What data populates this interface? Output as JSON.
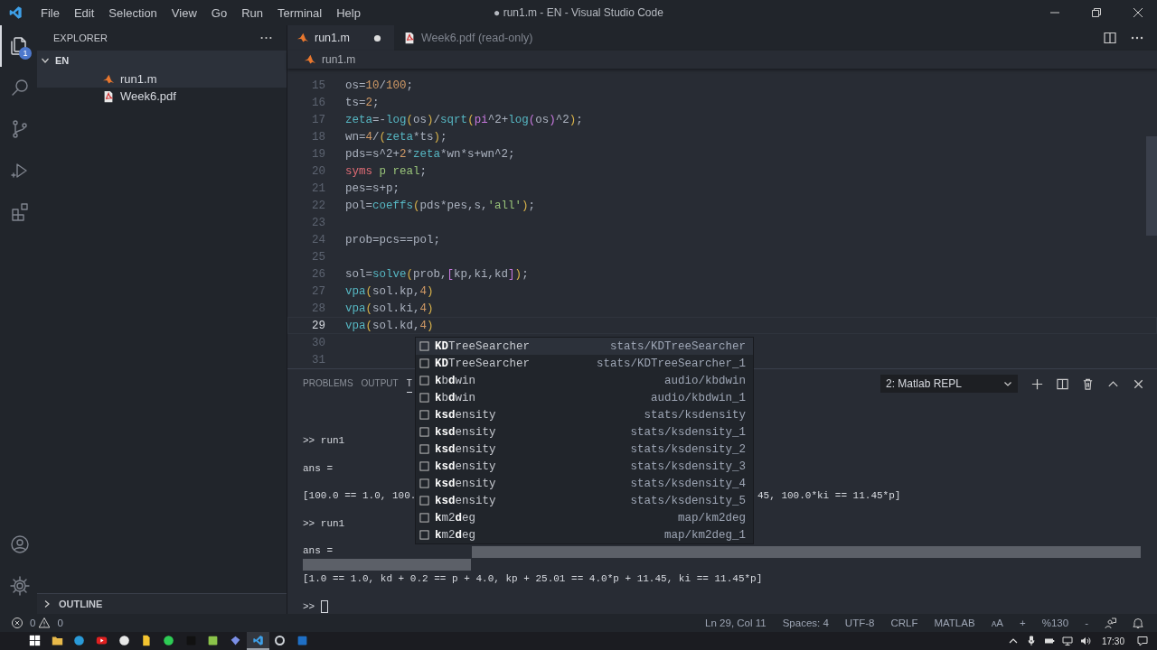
{
  "window": {
    "title": "● run1.m - EN - Visual Studio Code"
  },
  "menu": [
    "File",
    "Edit",
    "Selection",
    "View",
    "Go",
    "Run",
    "Terminal",
    "Help"
  ],
  "activity": [
    {
      "kind": "files",
      "selected": true,
      "badge": "1"
    },
    {
      "kind": "search",
      "selected": false
    },
    {
      "kind": "scm",
      "selected": false
    },
    {
      "kind": "run",
      "selected": false
    },
    {
      "kind": "extensions",
      "selected": false
    }
  ],
  "activity_bottom": [
    {
      "kind": "account"
    },
    {
      "kind": "settings"
    }
  ],
  "explorer": {
    "title": "EXPLORER",
    "folder": {
      "label": "EN",
      "expanded": true,
      "files": [
        {
          "label": "run1.m",
          "kind": "matlab",
          "selected": true
        },
        {
          "label": "Week6.pdf",
          "kind": "pdf",
          "selected": false
        }
      ]
    },
    "outline": {
      "label": "OUTLINE",
      "expanded": false
    }
  },
  "tabs": [
    {
      "label": "run1.m",
      "kind": "matlab",
      "selected": true,
      "dirty": true
    },
    {
      "label": "Week6.pdf (read-only)",
      "kind": "pdf",
      "selected": false,
      "dirty": false
    }
  ],
  "breadcrumb": {
    "label": "run1.m",
    "kind": "matlab"
  },
  "code": {
    "lines": [
      {
        "number": "15",
        "current": false,
        "tokens": [
          {
            "kind": "plain",
            "text": "os="
          },
          {
            "kind": "num",
            "text": "10"
          },
          {
            "kind": "plain",
            "text": "/"
          },
          {
            "kind": "num",
            "text": "100"
          },
          {
            "kind": "plain",
            "text": ";"
          }
        ]
      },
      {
        "number": "16",
        "current": false,
        "tokens": [
          {
            "kind": "plain",
            "text": "ts="
          },
          {
            "kind": "num",
            "text": "2"
          },
          {
            "kind": "plain",
            "text": ";"
          }
        ]
      },
      {
        "number": "17",
        "current": false,
        "tokens": [
          {
            "kind": "fn",
            "text": "zeta"
          },
          {
            "kind": "plain",
            "text": "=-"
          },
          {
            "kind": "fn",
            "text": "log"
          },
          {
            "kind": "p1",
            "text": "("
          },
          {
            "kind": "plain",
            "text": "os"
          },
          {
            "kind": "p1",
            "text": ")"
          },
          {
            "kind": "plain",
            "text": "/"
          },
          {
            "kind": "fn",
            "text": "sqrt"
          },
          {
            "kind": "p1",
            "text": "("
          },
          {
            "kind": "const",
            "text": "pi"
          },
          {
            "kind": "plain",
            "text": "^2+"
          },
          {
            "kind": "fn",
            "text": "log"
          },
          {
            "kind": "p2",
            "text": "("
          },
          {
            "kind": "plain",
            "text": "os"
          },
          {
            "kind": "p2",
            "text": ")"
          },
          {
            "kind": "plain",
            "text": "^2"
          },
          {
            "kind": "p1",
            "text": ")"
          },
          {
            "kind": "plain",
            "text": ";"
          }
        ]
      },
      {
        "number": "18",
        "current": false,
        "tokens": [
          {
            "kind": "plain",
            "text": "wn="
          },
          {
            "kind": "num",
            "text": "4"
          },
          {
            "kind": "plain",
            "text": "/"
          },
          {
            "kind": "p1",
            "text": "("
          },
          {
            "kind": "fn",
            "text": "zeta"
          },
          {
            "kind": "plain",
            "text": "*ts"
          },
          {
            "kind": "p1",
            "text": ")"
          },
          {
            "kind": "plain",
            "text": ";"
          }
        ]
      },
      {
        "number": "19",
        "current": false,
        "tokens": [
          {
            "kind": "plain",
            "text": "pds=s^2+"
          },
          {
            "kind": "num",
            "text": "2"
          },
          {
            "kind": "plain",
            "text": "*"
          },
          {
            "kind": "fn",
            "text": "zeta"
          },
          {
            "kind": "plain",
            "text": "*wn*s+wn^2;"
          }
        ]
      },
      {
        "number": "20",
        "current": false,
        "tokens": [
          {
            "kind": "kw",
            "text": "syms"
          },
          {
            "kind": "var",
            "text": " p"
          },
          {
            "kind": "var",
            "text": " real"
          },
          {
            "kind": "plain",
            "text": ";"
          }
        ]
      },
      {
        "number": "21",
        "current": false,
        "tokens": [
          {
            "kind": "plain",
            "text": "pes=s+p;"
          }
        ]
      },
      {
        "number": "22",
        "current": false,
        "tokens": [
          {
            "kind": "plain",
            "text": "pol="
          },
          {
            "kind": "fn",
            "text": "coeffs"
          },
          {
            "kind": "p1",
            "text": "("
          },
          {
            "kind": "plain",
            "text": "pds*pes,s,"
          },
          {
            "kind": "str",
            "text": "'all'"
          },
          {
            "kind": "p1",
            "text": ")"
          },
          {
            "kind": "plain",
            "text": ";"
          }
        ]
      },
      {
        "number": "23",
        "current": false
      },
      {
        "number": "24",
        "current": false,
        "tokens": [
          {
            "kind": "plain",
            "text": "prob=pcs==pol;"
          }
        ]
      },
      {
        "number": "25",
        "current": false
      },
      {
        "number": "26",
        "current": false,
        "tokens": [
          {
            "kind": "plain",
            "text": "sol="
          },
          {
            "kind": "fn",
            "text": "solve"
          },
          {
            "kind": "p1",
            "text": "("
          },
          {
            "kind": "plain",
            "text": "prob,"
          },
          {
            "kind": "p2",
            "text": "["
          },
          {
            "kind": "plain",
            "text": "kp,ki,kd"
          },
          {
            "kind": "p2",
            "text": "]"
          },
          {
            "kind": "p1",
            "text": ")"
          },
          {
            "kind": "plain",
            "text": ";"
          }
        ]
      },
      {
        "number": "27",
        "current": false,
        "tokens": [
          {
            "kind": "fn",
            "text": "vpa"
          },
          {
            "kind": "p1",
            "text": "("
          },
          {
            "kind": "plain",
            "text": "sol.kp,"
          },
          {
            "kind": "num",
            "text": "4"
          },
          {
            "kind": "p1",
            "text": ")"
          }
        ]
      },
      {
        "number": "28",
        "current": false,
        "tokens": [
          {
            "kind": "fn",
            "text": "vpa"
          },
          {
            "kind": "p1",
            "text": "("
          },
          {
            "kind": "plain",
            "text": "sol.ki,"
          },
          {
            "kind": "num",
            "text": "4"
          },
          {
            "kind": "p1",
            "text": ")"
          }
        ]
      },
      {
        "number": "29",
        "current": true,
        "tokens": [
          {
            "kind": "fn",
            "text": "vpa"
          },
          {
            "kind": "p1",
            "text": "("
          },
          {
            "kind": "plain",
            "text": "sol.kd,"
          },
          {
            "kind": "num",
            "text": "4"
          },
          {
            "kind": "p1",
            "text": ")"
          }
        ]
      },
      {
        "number": "30",
        "current": false
      },
      {
        "number": "31",
        "current": false
      }
    ]
  },
  "suggestions": [
    {
      "label": "**KD**TreeSearcher",
      "detail": "stats/KDTreeSearcher",
      "selected": true
    },
    {
      "label": "**KD**TreeSearcher",
      "detail": "stats/KDTreeSearcher_1",
      "selected": false
    },
    {
      "label": "**k**b**d**win",
      "detail": "audio/kbdwin",
      "selected": false
    },
    {
      "label": "**k**b**d**win",
      "detail": "audio/kbdwin_1",
      "selected": false
    },
    {
      "label": "**ksd**ensity",
      "detail": "stats/ksdensity",
      "selected": false
    },
    {
      "label": "**ksd**ensity",
      "detail": "stats/ksdensity_1",
      "selected": false
    },
    {
      "label": "**ksd**ensity",
      "detail": "stats/ksdensity_2",
      "selected": false
    },
    {
      "label": "**ksd**ensity",
      "detail": "stats/ksdensity_3",
      "selected": false
    },
    {
      "label": "**ksd**ensity",
      "detail": "stats/ksdensity_4",
      "selected": false
    },
    {
      "label": "**ksd**ensity",
      "detail": "stats/ksdensity_5",
      "selected": false
    },
    {
      "label": "**k**m2**d**eg",
      "detail": "map/km2deg",
      "selected": false
    },
    {
      "label": "**k**m2**d**eg",
      "detail": "map/km2deg_1",
      "selected": false
    }
  ],
  "panel": {
    "tabs": [
      {
        "label": "PROBLEMS",
        "selected": false
      },
      {
        "label": "OUTPUT",
        "selected": false
      },
      {
        "label": "T",
        "selected": true
      }
    ],
    "terminal_select": "2: Matlab REPL",
    "terminal": [
      {
        "kind": "output",
        "text": ">> run1"
      },
      {
        "kind": "output",
        "text": "ans ="
      },
      {
        "kind": "split",
        "text": "[100.0 == 1.0, 100.",
        "text_right": "45, 100.0*ki == 11.45*p]"
      },
      {
        "kind": "output",
        "text": ">> run1"
      },
      {
        "kind": "output",
        "text": "ans ="
      },
      {
        "kind": "output",
        "text": "[1.0 == 1.0, kd + 0.2 == p + 4.0, kp + 25.01 == 4.0*p + 11.45, ki == 11.45*p]"
      },
      {
        "kind": "prompt",
        "text": ">>"
      }
    ]
  },
  "status_bar": {
    "errors": "0",
    "warnings": "0",
    "items": [
      "Ln 29, Col 11",
      "Spaces: 4",
      "UTF-8",
      "CRLF",
      "MATLAB",
      "ᴀA",
      "+",
      "%130",
      "-"
    ]
  },
  "taskbar": {
    "apps": [
      {
        "kind": "start",
        "selected": false
      },
      {
        "kind": "folder",
        "selected": false
      },
      {
        "kind": "browser",
        "selected": false
      },
      {
        "kind": "video",
        "selected": false
      },
      {
        "kind": "circle",
        "selected": false
      },
      {
        "kind": "document",
        "selected": false
      },
      {
        "kind": "chat",
        "selected": false
      },
      {
        "kind": "dark",
        "selected": false
      },
      {
        "kind": "green",
        "selected": false
      },
      {
        "kind": "diamond",
        "selected": false
      },
      {
        "kind": "editor",
        "selected": true
      },
      {
        "kind": "grey",
        "selected": false
      },
      {
        "kind": "mail",
        "selected": false
      }
    ],
    "time": "17:30"
  }
}
